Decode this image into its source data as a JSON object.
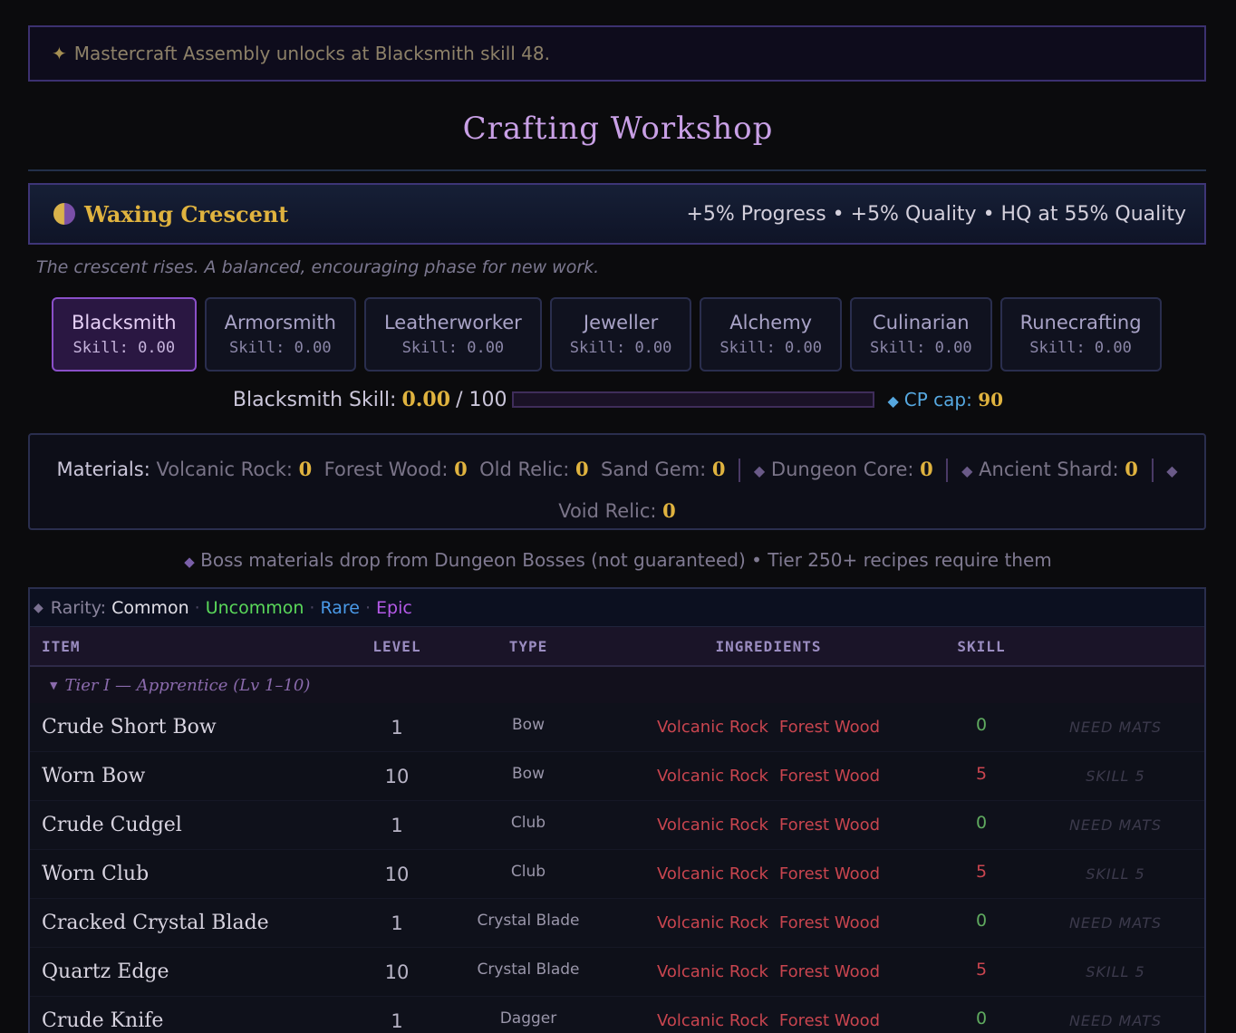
{
  "notice": {
    "icon": "sparkle-icon",
    "text": "Mastercraft Assembly unlocks at Blacksmith skill 48."
  },
  "title": "Crafting Workshop",
  "moon": {
    "icon": "moon-phase-icon",
    "name": "Waxing Crescent",
    "effects": "+5% Progress • +5% Quality • HQ at 55% Quality",
    "flavor": "The crescent rises. A balanced, encouraging phase for new work."
  },
  "tabs": [
    {
      "name": "Blacksmith",
      "skill": "Skill: 0.00",
      "active": true
    },
    {
      "name": "Armorsmith",
      "skill": "Skill: 0.00"
    },
    {
      "name": "Leatherworker",
      "skill": "Skill: 0.00"
    },
    {
      "name": "Jeweller",
      "skill": "Skill: 0.00"
    },
    {
      "name": "Alchemy",
      "skill": "Skill: 0.00"
    },
    {
      "name": "Culinarian",
      "skill": "Skill: 0.00"
    },
    {
      "name": "Runecrafting",
      "skill": "Skill: 0.00"
    }
  ],
  "skillbar": {
    "label": "Blacksmith Skill:",
    "value": "0.00",
    "max": "/ 100",
    "progress": 0,
    "cp_label": "CP cap:",
    "cp_value": "90"
  },
  "materials": {
    "label": "Materials:",
    "common": [
      {
        "name": "Volcanic Rock:",
        "count": "0"
      },
      {
        "name": "Forest Wood:",
        "count": "0"
      },
      {
        "name": "Old Relic:",
        "count": "0"
      },
      {
        "name": "Sand Gem:",
        "count": "0"
      }
    ],
    "boss": [
      {
        "name": "Dungeon Core:",
        "count": "0"
      },
      {
        "name": "Ancient Shard:",
        "count": "0"
      },
      {
        "name": "Void Relic:",
        "count": "0"
      }
    ]
  },
  "boss_note": "Boss materials drop from Dungeon Bosses (not guaranteed) • Tier 250+ recipes require them",
  "rarity": {
    "label": "Rarity:",
    "levels": [
      "Common",
      "Uncommon",
      "Rare",
      "Epic"
    ],
    "colors": {
      "common": "#e2e0e8",
      "uncommon": "#5ad85a",
      "rare": "#4a9ae8",
      "epic": "#b55ae8"
    }
  },
  "table": {
    "headers": {
      "item": "ITEM",
      "level": "LEVEL",
      "type": "TYPE",
      "ingredients": "INGREDIENTS",
      "skill": "SKILL"
    },
    "tier": "Tier I — Apprentice (Lv 1–10)",
    "rows": [
      {
        "item": "Crude Short Bow",
        "level": "1",
        "type": "Bow",
        "ing": [
          "Volcanic Rock",
          "Forest Wood"
        ],
        "skill": "0",
        "ok": true,
        "action": "NEED MATS"
      },
      {
        "item": "Worn Bow",
        "level": "10",
        "type": "Bow",
        "ing": [
          "Volcanic Rock",
          "Forest Wood"
        ],
        "skill": "5",
        "ok": false,
        "action": "SKILL 5"
      },
      {
        "item": "Crude Cudgel",
        "level": "1",
        "type": "Club",
        "ing": [
          "Volcanic Rock",
          "Forest Wood"
        ],
        "skill": "0",
        "ok": true,
        "action": "NEED MATS"
      },
      {
        "item": "Worn Club",
        "level": "10",
        "type": "Club",
        "ing": [
          "Volcanic Rock",
          "Forest Wood"
        ],
        "skill": "5",
        "ok": false,
        "action": "SKILL 5"
      },
      {
        "item": "Cracked Crystal Blade",
        "level": "1",
        "type": "Crystal Blade",
        "ing": [
          "Volcanic Rock",
          "Forest Wood"
        ],
        "skill": "0",
        "ok": true,
        "action": "NEED MATS"
      },
      {
        "item": "Quartz Edge",
        "level": "10",
        "type": "Crystal Blade",
        "ing": [
          "Volcanic Rock",
          "Forest Wood"
        ],
        "skill": "5",
        "ok": false,
        "action": "SKILL 5"
      },
      {
        "item": "Crude Knife",
        "level": "1",
        "type": "Dagger",
        "ing": [
          "Volcanic Rock",
          "Forest Wood"
        ],
        "skill": "0",
        "ok": true,
        "action": "NEED MATS"
      }
    ]
  }
}
